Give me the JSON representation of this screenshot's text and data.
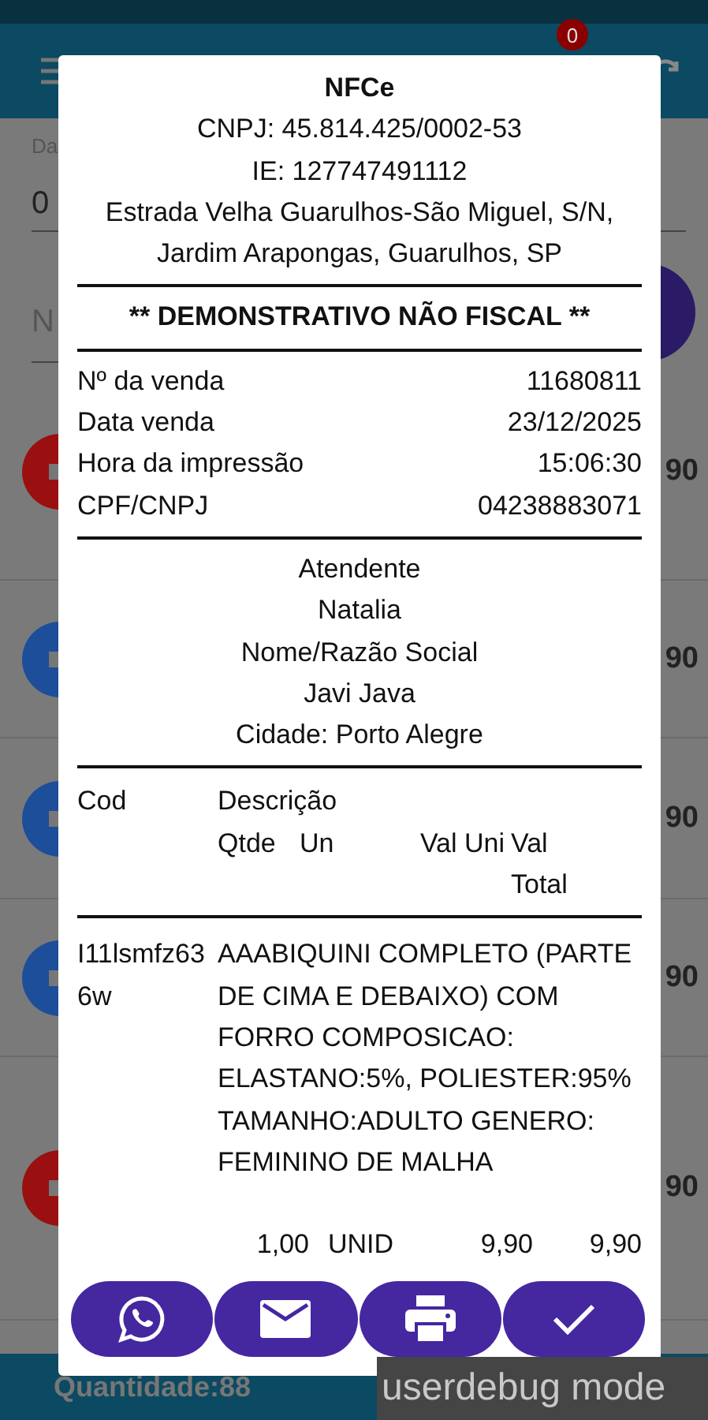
{
  "app_bar": {
    "badge": "0"
  },
  "filters": {
    "date_label": "Da",
    "date_value": "0",
    "search_placeholder": "N"
  },
  "rows": [
    {
      "color": "#9a1010",
      "value": "90"
    },
    {
      "color": "#1d4e9a",
      "value": "90"
    },
    {
      "color": "#1d4e9a",
      "value": "90"
    },
    {
      "color": "#1d4e9a",
      "value": "90"
    },
    {
      "color": "#9a1010",
      "value": "90"
    }
  ],
  "footer": {
    "quantity": "Quantidade:88"
  },
  "receipt": {
    "title": "NFCe",
    "header_lines": [
      "CNPJ: 45.814.425/0002-53",
      "IE: 127747491112",
      "Estrada Velha Guarulhos-São Miguel, S/N, Jardim Arapongas, Guarulhos, SP"
    ],
    "banner": "** DEMONSTRATIVO NÃO FISCAL **",
    "fields": [
      {
        "label": "Nº da venda",
        "value": "11680811"
      },
      {
        "label": "Data venda",
        "value": "23/12/2025"
      },
      {
        "label": "Hora da impressão",
        "value": "15:06:30"
      },
      {
        "label": "CPF/CNPJ",
        "value": "04238883071"
      }
    ],
    "center_lines": [
      "Atendente",
      "Natalia",
      "Nome/Razão Social",
      "Javi Java",
      "Cidade: Porto Alegre"
    ],
    "columns": {
      "code": "Cod",
      "description": "Descrição",
      "qty": "Qtde",
      "unit": "Un",
      "unit_price": "Val Uni",
      "total": "Val Total"
    },
    "items": [
      {
        "code": "I11lsmfz636w",
        "description": "AAABIQUINI COMPLETO (PARTE DE CIMA E DEBAIXO) COM FORRO COMPOSICAO: ELASTANO:5%, POLIESTER:95% TAMANHO:ADULTO GENERO: FEMININO DE MALHA",
        "qty": "1,00",
        "unit": "UNID",
        "unit_price": "9,90",
        "total": "9,90"
      }
    ]
  },
  "actions": [
    {
      "kind": "chat"
    },
    {
      "kind": "email"
    },
    {
      "kind": "print"
    },
    {
      "kind": "confirm"
    }
  ],
  "system_overlay": "userdebug mode"
}
